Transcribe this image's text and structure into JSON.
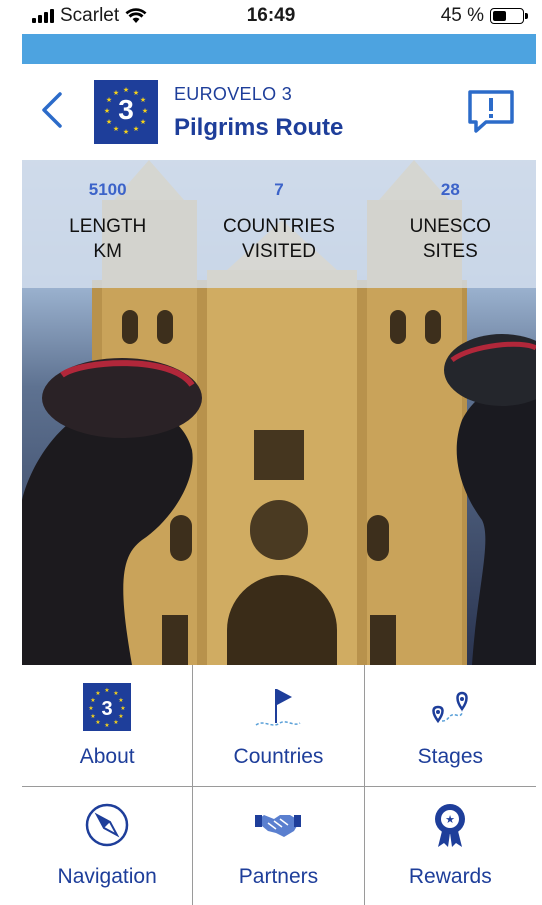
{
  "status_bar": {
    "carrier": "Scarlet",
    "time": "16:49",
    "battery_text": "45 %",
    "battery_level": 0.45
  },
  "header": {
    "route_number": "3",
    "route_code": "EUROVELO 3",
    "route_name": "Pilgrims Route"
  },
  "stats": [
    {
      "value": "5100",
      "label": "LENGTH\nKM"
    },
    {
      "value": "7",
      "label": "COUNTRIES\nVISITED"
    },
    {
      "value": "28",
      "label": "UNESCO\nSITES"
    }
  ],
  "menu": [
    {
      "label": "About",
      "icon": "eurovelo-logo-icon"
    },
    {
      "label": "Countries",
      "icon": "flag-icon"
    },
    {
      "label": "Stages",
      "icon": "route-pins-icon"
    },
    {
      "label": "Navigation",
      "icon": "compass-icon"
    },
    {
      "label": "Partners",
      "icon": "handshake-icon"
    },
    {
      "label": "Rewards",
      "icon": "award-icon"
    }
  ],
  "colors": {
    "accent": "#1e3e9a",
    "stat_value": "#3c63c9",
    "top_bar": "#4da3e0"
  }
}
